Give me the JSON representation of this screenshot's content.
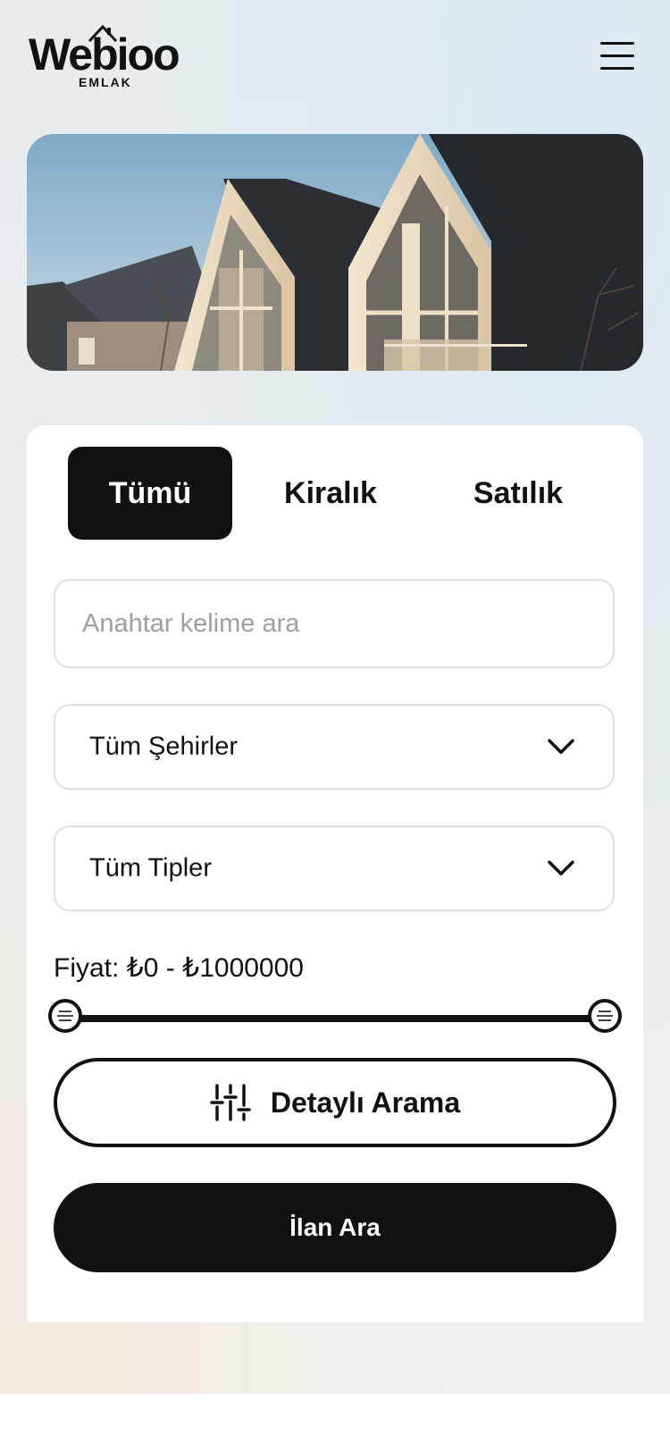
{
  "brand": {
    "name": "Webioo",
    "sub": "EMLAK"
  },
  "header": {
    "menu_icon": "hamburger-menu-icon"
  },
  "hero": {
    "alt": ""
  },
  "search": {
    "tabs": [
      {
        "label": "Tümü",
        "active": true
      },
      {
        "label": "Kiralık",
        "active": false
      },
      {
        "label": "Satılık",
        "active": false
      }
    ],
    "keyword_placeholder": "Anahtar kelime ara",
    "keyword_value": "",
    "city_select": "Tüm Şehirler",
    "type_select": "Tüm Tipler",
    "price_label": "Fiyat: ₺0 - ₺1000000",
    "price_min": 0,
    "price_max": 1000000,
    "price_range_fraction": [
      0,
      1
    ],
    "detailed_search_label": "Detaylı Arama",
    "detailed_search_icon": "sliders-icon",
    "submit_label": "İlan Ara"
  },
  "colors": {
    "primary": "#111111",
    "border": "#dedede",
    "placeholder": "#9b9fa4"
  }
}
